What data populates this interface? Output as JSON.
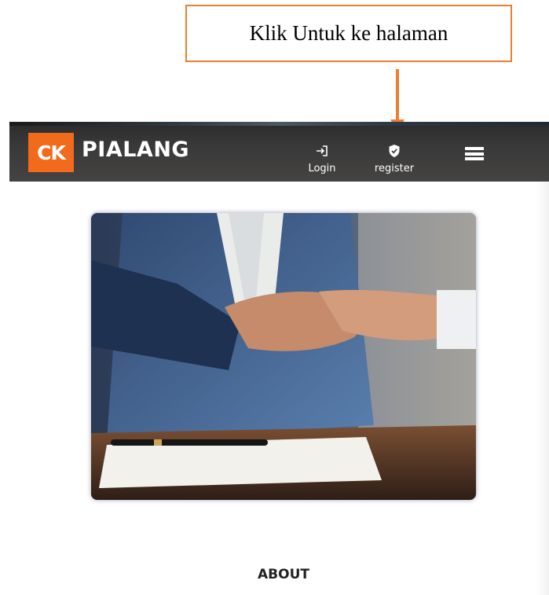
{
  "annotation": {
    "callout_text": "Klik Untuk ke halaman",
    "accent_color": "#ed7d31"
  },
  "navbar": {
    "logo_badge": "CK",
    "logo_text": "PIALANG",
    "brand_color": "#f26a1b",
    "items": [
      {
        "label": "Login",
        "icon": "login-icon"
      },
      {
        "label": "register",
        "icon": "shield-check-icon"
      }
    ],
    "menu_icon": "hamburger-menu-icon"
  },
  "hero": {
    "image": "handshake-photo"
  },
  "section": {
    "title": "ABOUT"
  }
}
